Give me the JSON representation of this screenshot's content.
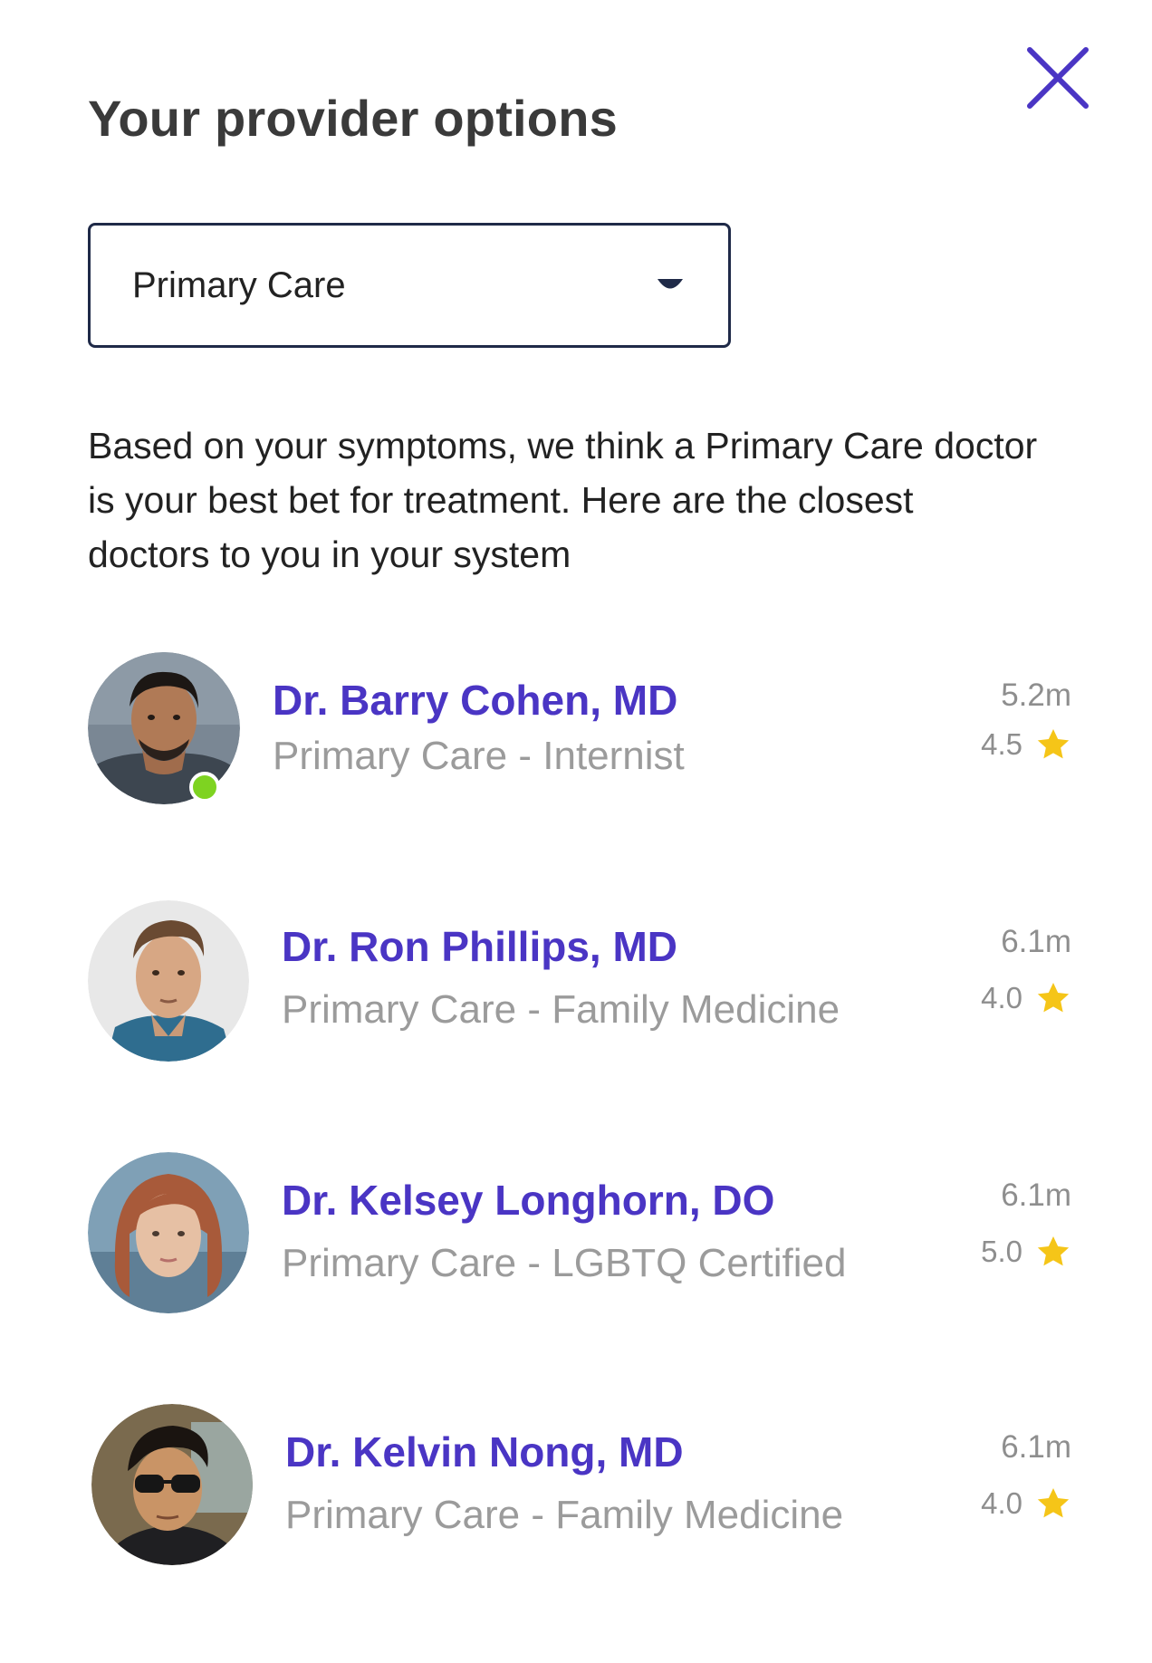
{
  "header": {
    "title": "Your provider options"
  },
  "specialty_select": {
    "selected": "Primary Care"
  },
  "intro_text": "Based on your symptoms, we think a Primary Care doctor is your best bet for treatment. Here are the closest doctors to you in your system",
  "colors": {
    "accent": "#4a35c4",
    "online": "#7ed321",
    "star": "#f5c518"
  },
  "providers": [
    {
      "name": "Dr. Barry Cohen, MD",
      "specialty": "Primary Care - Internist",
      "distance": "5.2m",
      "rating": "4.5",
      "online": true
    },
    {
      "name": "Dr. Ron Phillips, MD",
      "specialty": "Primary Care - Family Medicine",
      "distance": "6.1m",
      "rating": "4.0",
      "online": false
    },
    {
      "name": "Dr. Kelsey Longhorn, DO",
      "specialty": "Primary Care - LGBTQ Certified",
      "distance": "6.1m",
      "rating": "5.0",
      "online": false
    },
    {
      "name": "Dr. Kelvin Nong, MD",
      "specialty": "Primary Care - Family Medicine",
      "distance": "6.1m",
      "rating": "4.0",
      "online": false
    }
  ]
}
